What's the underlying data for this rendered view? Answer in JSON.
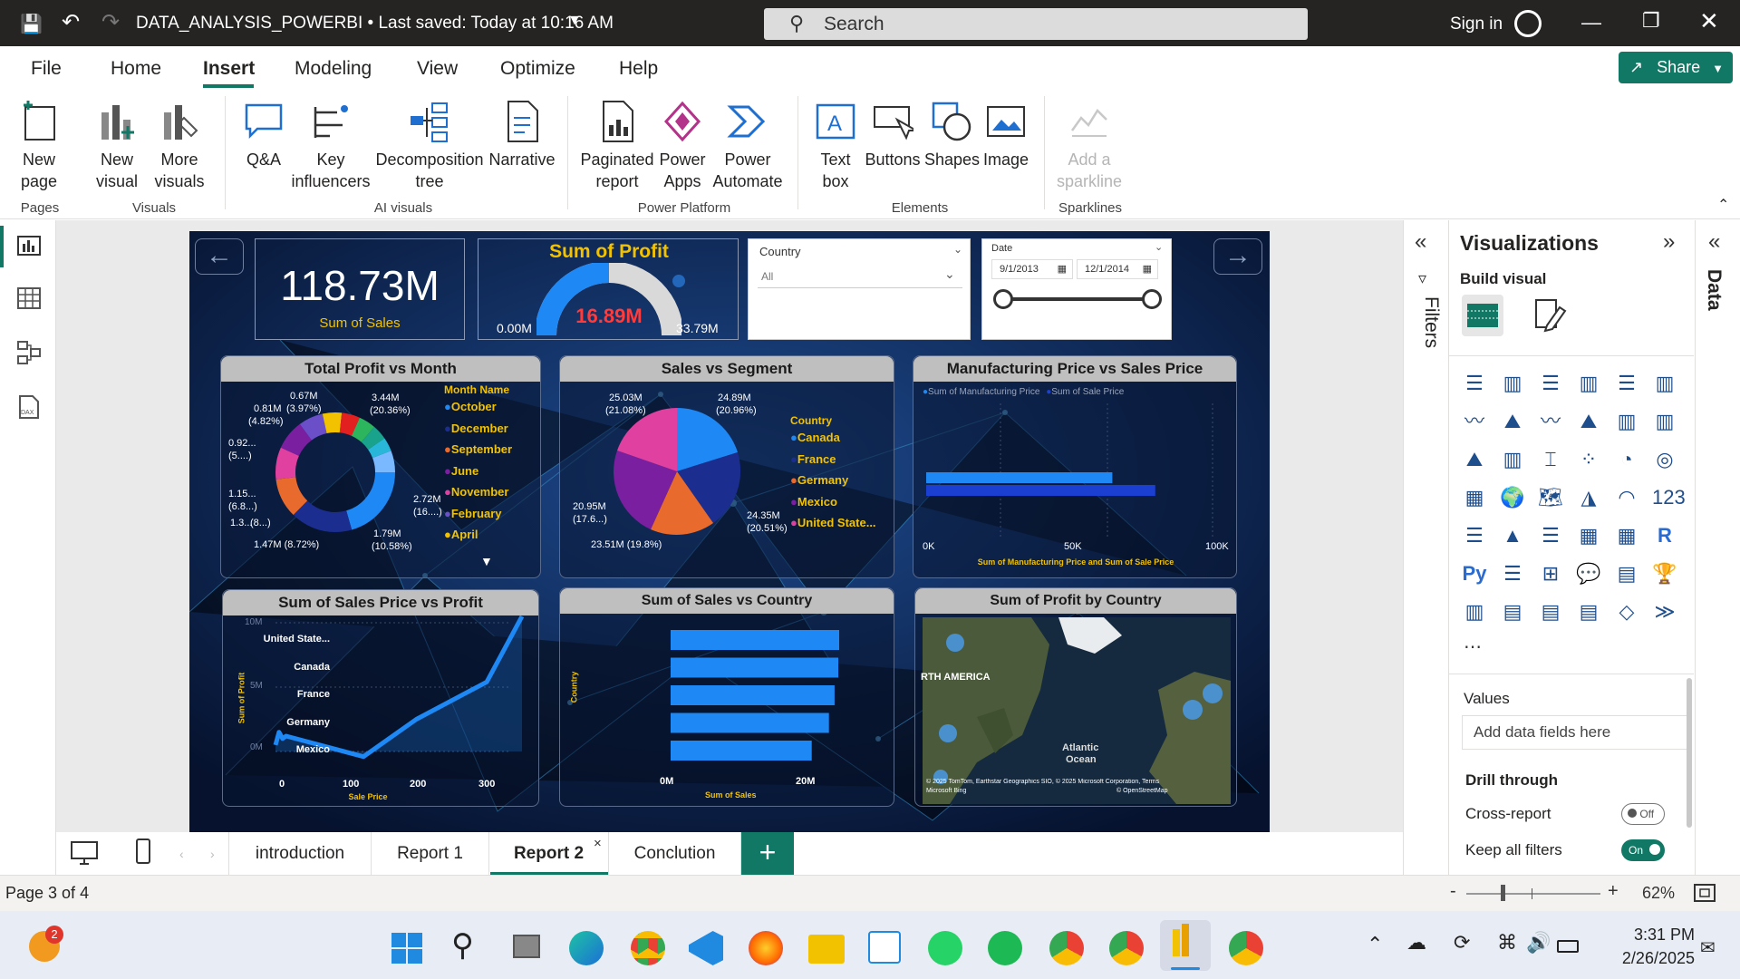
{
  "titlebar": {
    "doc_title": "DATA_ANALYSIS_POWERBI • Last saved: Today at 10:16 AM",
    "search_placeholder": "Search",
    "sign_in": "Sign in"
  },
  "ribbon": {
    "tabs": [
      "File",
      "Home",
      "Insert",
      "Modeling",
      "View",
      "Optimize",
      "Help"
    ],
    "active_tab": "Insert",
    "share_label": "Share",
    "buttons": {
      "new_page": "New page",
      "new_visual": "New visual",
      "more_visuals": "More visuals",
      "qa": "Q&A",
      "key_influencers": "Key influencers",
      "decomposition_tree": "Decomposition tree",
      "narrative": "Narrative",
      "paginated_report": "Paginated report",
      "power_apps": "Power Apps",
      "power_automate": "Power Automate",
      "text_box": "Text box",
      "buttons": "Buttons",
      "shapes": "Shapes",
      "image": "Image",
      "add_sparkline": "Add a sparkline"
    },
    "groups": {
      "pages": "Pages",
      "visuals": "Visuals",
      "ai_visuals": "AI visuals",
      "power_platform": "Power Platform",
      "elements": "Elements",
      "sparklines": "Sparklines"
    }
  },
  "report": {
    "kpi_value": "118.73M",
    "kpi_label": "Sum of Sales",
    "gauge_title": "Sum of Profit",
    "gauge_value": "16.89M",
    "gauge_min": "0.00M",
    "gauge_max": "33.79M",
    "gauge_fraction": 0.5,
    "country_slicer_label": "Country",
    "country_slicer_value": "All",
    "date_slicer_label": "Date",
    "date_start": "9/1/2013",
    "date_end": "12/1/2014",
    "donut_title": "Total Profit vs Month",
    "donut_legend_title": "Month Name",
    "donut_legend": [
      "October",
      "December",
      "September",
      "June",
      "November",
      "February",
      "April"
    ],
    "donut_labels": [
      "0.67M",
      "(3.97%)",
      "0.81M",
      "(4.82%)",
      "3.44M",
      "(20.36%)",
      "0.92...",
      "(5....)",
      "1.15...",
      "(6.8...)",
      "1.3...",
      "(8...)",
      "2.72M",
      "(16....)",
      "1.47M (8.72%)",
      "1.79M",
      "(10.58%)"
    ],
    "pie_title": "Sales vs Segment",
    "pie_legend_title": "Country",
    "pie_legend": [
      "Canada",
      "France",
      "Germany",
      "Mexico",
      "United State..."
    ],
    "pie_labels": [
      "25.03M",
      "(21.08%)",
      "24.89M",
      "(20.96%)",
      "20.95M",
      "(17.6...)",
      "24.35M",
      "(20.51%)",
      "23.51M (19.8%)"
    ],
    "bar1_title": "Manufacturing Price vs Sales Price",
    "bar1_legend": [
      "Sum of Manufacturing Price",
      "Sum of Sale Price"
    ],
    "bar1_xticks": [
      "0K",
      "50K",
      "100K"
    ],
    "bar1_xlabel": "Sum of Manufacturing Price and Sum of Sale Price",
    "line_title": "Sum of Sales Price vs Profit",
    "line_yticks": [
      "10M",
      "5M",
      "0M"
    ],
    "line_xticks": [
      "0",
      "100",
      "200",
      "300"
    ],
    "line_ylabel": "Sum of Profit",
    "line_xlabel": "Sale Price",
    "bar2_title": "Sum of Sales vs Country",
    "bar2_ylabel": "Country",
    "bar2_xlabel": "Sum of Sales",
    "bar2_xticks": [
      "0M",
      "20M"
    ],
    "map_title": "Sum of Profit by Country",
    "map_labels": [
      "RTH AMERICA",
      "Atlantic",
      "Ocean"
    ],
    "map_attrib": "© 2025 TomTom, Earthstar Geographics SIO, © 2025 Microsoft Corporation, Terms",
    "map_attrib2": "© OpenStreetMap",
    "map_brand": "Microsoft Bing"
  },
  "chart_data": [
    {
      "type": "bar",
      "title": "Manufacturing Price vs Sales Price",
      "series": [
        {
          "name": "Sum of Manufacturing Price",
          "values": [
            65000
          ]
        },
        {
          "name": "Sum of Sale Price",
          "values": [
            80000
          ]
        }
      ],
      "xlim": [
        0,
        100000
      ],
      "orientation": "horizontal"
    },
    {
      "type": "bar",
      "title": "Sum of Sales vs Country",
      "categories": [
        "United State...",
        "Canada",
        "France",
        "Germany",
        "Mexico"
      ],
      "values": [
        25.03,
        24.89,
        24.35,
        23.51,
        20.95
      ],
      "xlim": [
        0,
        30
      ],
      "orientation": "horizontal"
    },
    {
      "type": "line",
      "title": "Sum of Sales Price vs Profit",
      "x": [
        0,
        5,
        10,
        15,
        125,
        200,
        300,
        350
      ],
      "y": [
        0.5,
        1.5,
        1.0,
        1.2,
        -0.4,
        2.5,
        5.4,
        10.5
      ],
      "ylim": [
        0,
        10
      ],
      "xlim": [
        0,
        350
      ]
    }
  ],
  "panes": {
    "filters": "Filters",
    "visualizations": "Visualizations",
    "build_visual": "Build visual",
    "data": "Data",
    "values_label": "Values",
    "values_placeholder": "Add data fields here",
    "drill_through": "Drill through",
    "cross_report": "Cross-report",
    "cross_report_state": "Off",
    "keep_filters": "Keep all filters",
    "keep_filters_state": "On"
  },
  "pages": {
    "tabs": [
      "introduction",
      "Report 1",
      "Report 2",
      "Conclution"
    ],
    "active": "Report 2",
    "indicator": "Page 3 of 4",
    "zoom": "62%"
  },
  "taskbar": {
    "time": "3:31 PM",
    "date": "2/26/2025",
    "badge": "2"
  }
}
